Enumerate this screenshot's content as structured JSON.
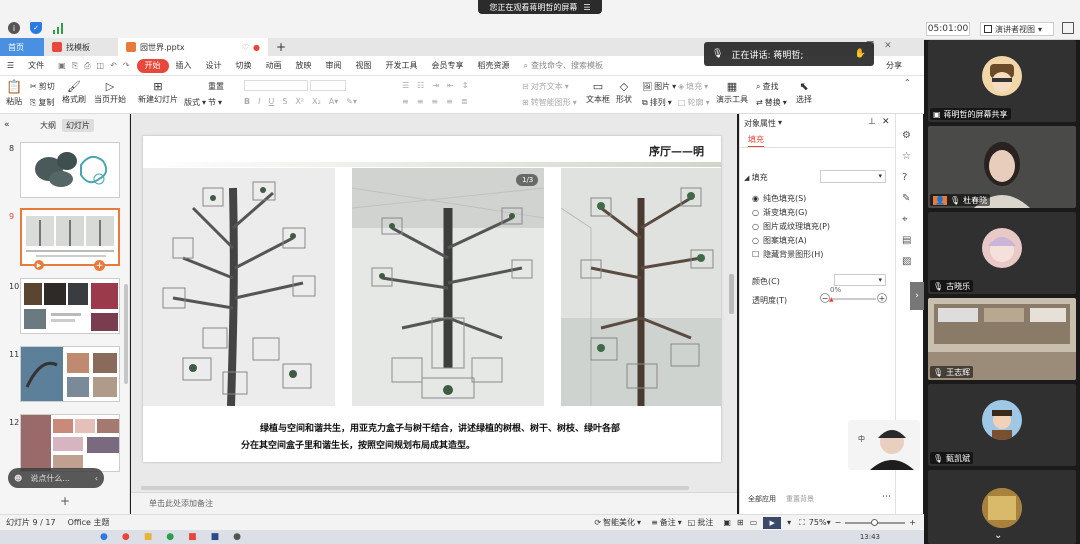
{
  "meeting": {
    "watch_banner": "您正在观看蒋明哲的屏幕",
    "timer": "05:01:00",
    "presenter_view": "演讲者视图",
    "speaking": "正在讲话: 蒋明哲;"
  },
  "tabs": [
    {
      "label": "首页"
    },
    {
      "label": "找模板"
    },
    {
      "label": "园世界.pptx"
    }
  ],
  "menu": {
    "file": "文件",
    "items": [
      "开始",
      "插入",
      "设计",
      "切换",
      "动画",
      "放映",
      "审阅",
      "视图",
      "开发工具",
      "会员专享",
      "稻壳资源"
    ],
    "search": "查找命令、搜索模板",
    "share": "分享"
  },
  "ribbon": {
    "paste": "粘贴",
    "cut": "剪切",
    "copy": "复制",
    "format_painter": "格式刷",
    "from_current": "当页开始",
    "new_slide": "新建幻灯片",
    "layout": "版式",
    "section": "节",
    "reset": "重置",
    "align_text": "对齐文本",
    "smart_graphic": "转智能图形",
    "textbox": "文本框",
    "shape": "形状",
    "picture": "图片",
    "arrange": "排列",
    "fill": "填充",
    "outline": "轮廓",
    "presentation_tools": "演示工具",
    "find": "查找",
    "replace": "替换",
    "select": "选择"
  },
  "left_panel": {
    "tab_outline": "大纲",
    "tab_slides": "幻灯片",
    "slide_numbers": [
      "8",
      "9",
      "10",
      "11",
      "12"
    ],
    "add_comment_placeholder": "说点什么...",
    "notes_hint": "单击此处添加备注"
  },
  "slide": {
    "title": "序厅——明",
    "counter": "1/3",
    "caption_line1": "绿植与空间和谐共生，用亚克力盒子与树干结合，讲述绿植的树根、树干、树枝、绿叶各部",
    "caption_line2": "分在其空间盒子里和谐生长，按照空间规划布局成其造型。"
  },
  "properties": {
    "header": "对象属性",
    "tab_fill": "填充",
    "section_fill": "填充",
    "options": [
      "纯色填充(S)",
      "渐变填充(G)",
      "图片或纹理填充(P)",
      "图案填充(A)"
    ],
    "hide_bg": "隐藏背景图形(H)",
    "color_label": "颜色(C)",
    "transparency_label": "透明度(T)",
    "transparency_value": "0%",
    "apply_all": "全部应用",
    "reset_bg": "重置背景"
  },
  "status": {
    "slide_info": "幻灯片 9 / 17",
    "theme": "Office 主题",
    "smart_beautify": "智能美化",
    "notes": "备注",
    "comments": "批注",
    "zoom": "75%"
  },
  "taskbar": {
    "time": "13:43"
  },
  "participants": [
    {
      "name": "蒋明哲的屏幕共享"
    },
    {
      "name": "杜春晓"
    },
    {
      "name": "古晓乐"
    },
    {
      "name": "王志辉"
    },
    {
      "name": "甄凯斌"
    }
  ],
  "colors": {
    "accent_orange": "#e8473b",
    "tab_blue": "#4a90e2",
    "wps_red": "#e8473b"
  }
}
